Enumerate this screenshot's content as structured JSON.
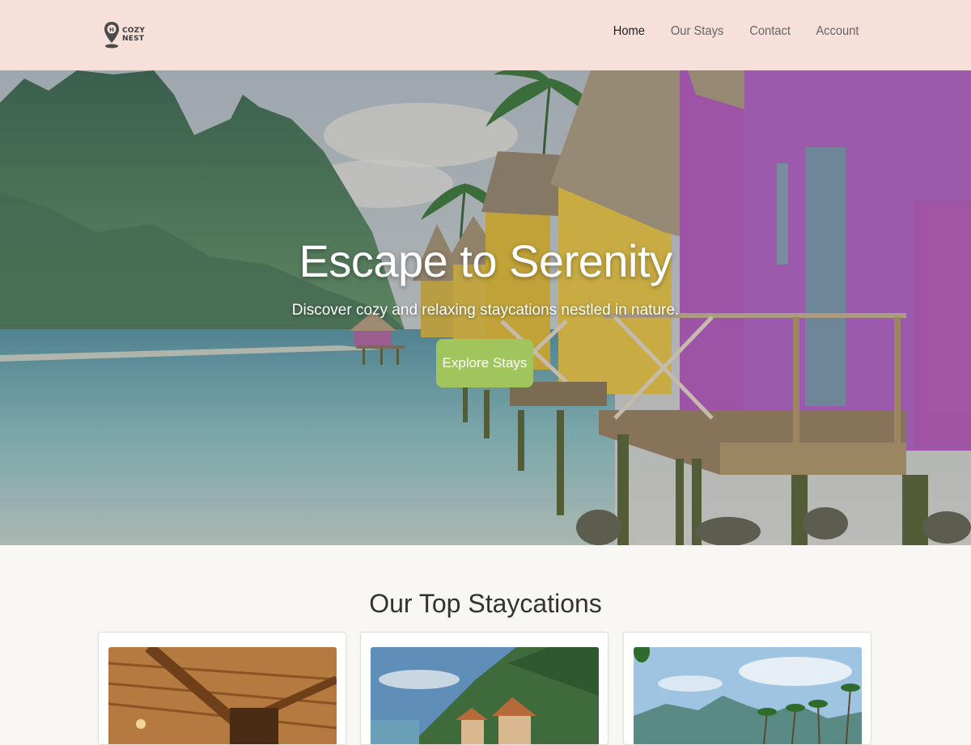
{
  "header": {
    "logo_text_line1": "COZY",
    "logo_text_line2": "NEST",
    "nav": [
      {
        "label": "Home",
        "active": true
      },
      {
        "label": "Our Stays",
        "active": false
      },
      {
        "label": "Contact",
        "active": false
      },
      {
        "label": "Account",
        "active": false
      }
    ]
  },
  "hero": {
    "title": "Escape to Serenity",
    "subtitle": "Discover cozy and relaxing staycations nestled in nature.",
    "cta_label": "Explore Stays"
  },
  "section": {
    "title": "Our Top Staycations"
  },
  "colors": {
    "header_bg": "#f6e0d9",
    "cta_bg": "#a1c55d",
    "page_bg": "#f9f7f4"
  }
}
